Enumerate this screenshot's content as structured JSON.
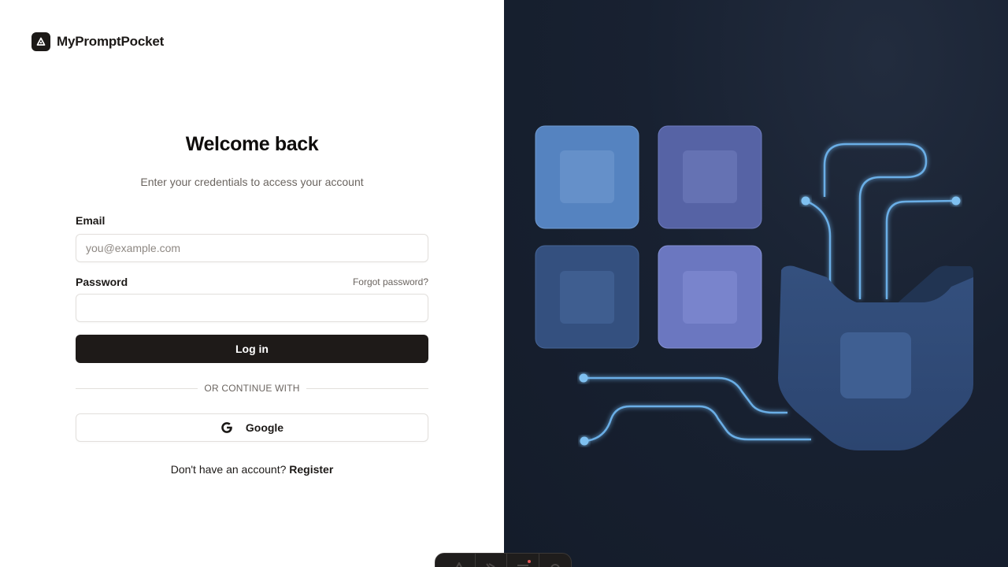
{
  "brand": {
    "name": "MyPromptPocket",
    "logo_icon": "brand-logo-icon"
  },
  "login": {
    "title": "Welcome back",
    "subtitle": "Enter your credentials to access your account",
    "email_label": "Email",
    "email_placeholder": "you@example.com",
    "email_value": "",
    "password_label": "Password",
    "password_value": "",
    "forgot_label": "Forgot password?",
    "submit_label": "Log in",
    "divider_label": "OR CONTINUE WITH",
    "google_label": "Google",
    "google_icon": "google-icon",
    "no_account_text": "Don't have an account?",
    "register_label": "Register"
  },
  "dock": {
    "items": [
      {
        "icon": "brand-mark-icon"
      },
      {
        "icon": "pointer-tool-icon"
      },
      {
        "icon": "menu-icon",
        "has_notification": true
      },
      {
        "icon": "gear-icon"
      }
    ]
  },
  "theme": {
    "primary_button": "#1e1a18",
    "illustration_bg": "#141c2a",
    "accent_glow": "#7bb8e8"
  }
}
